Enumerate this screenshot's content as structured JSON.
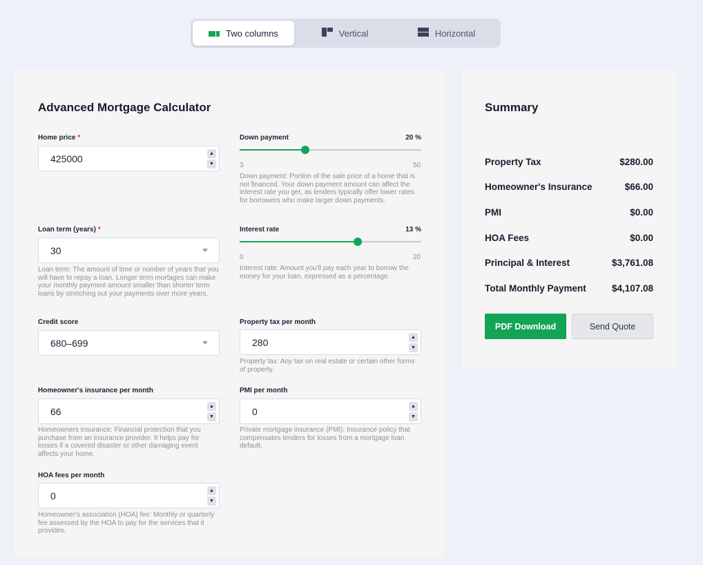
{
  "layout_switcher": {
    "tabs": [
      {
        "label": "Two columns",
        "icon": "two-columns-icon",
        "active": true
      },
      {
        "label": "Vertical",
        "icon": "vertical-layout-icon",
        "active": false
      },
      {
        "label": "Horizontal",
        "icon": "horizontal-layout-icon",
        "active": false
      }
    ]
  },
  "calculator": {
    "title": "Advanced Mortgage Calculator",
    "home_price": {
      "label": "Home price",
      "required_mark": "*",
      "value": "425000"
    },
    "down_payment": {
      "label": "Down payment",
      "value_text": "20 %",
      "value": 20,
      "min": 3,
      "max": 50,
      "min_label": "3",
      "max_label": "50",
      "help": "Down payment: Portion of the sale price of a home that is not financed. Your down payment amount can affect the interest rate you get, as lenders typically offer lower rates for borrowers who make larger down payments."
    },
    "loan_term": {
      "label": "Loan term (years)",
      "required_mark": "*",
      "value": "30",
      "help": "Loan term: The amount of time or number of years that you will have to repay a loan. Longer term mortages can make your monthly payment amount smaller than shorter term loans by stretching out your payments over more years."
    },
    "interest_rate": {
      "label": "Interest rate",
      "value_text": "13 %",
      "value": 13,
      "min": 0,
      "max": 20,
      "min_label": "0",
      "max_label": "20",
      "help": "Interest rate: Amount you'll pay each year to borrow the money for your loan, expressed as a percentage."
    },
    "credit_score": {
      "label": "Credit score",
      "value": "680–699"
    },
    "property_tax": {
      "label": "Property tax per month",
      "value": "280",
      "help": "Property tax: Any tax on real estate or certain other forms of property."
    },
    "homeowners_insurance": {
      "label": "Homeowner's insurance per month",
      "value": "66",
      "help": "Homeowners insurance: Financial protection that you purchase from an insurance provider. It helps pay for losses if a covered disaster or other damaging event affects your home."
    },
    "pmi": {
      "label": "PMI per month",
      "value": "0",
      "help": "Private mortgage insurance (PMI): Insurance policy that compensates lenders for losses from a mortgage loan default."
    },
    "hoa_fees": {
      "label": "HOA fees per month",
      "value": "0",
      "help": "Homeowner's association (HOA) fee: Monthly or quarterly fee assessed by the HOA to pay for the services that it provides."
    }
  },
  "summary": {
    "title": "Summary",
    "rows": [
      {
        "label": "Property Tax",
        "value": "$280.00"
      },
      {
        "label": "Homeowner's Insurance",
        "value": "$66.00"
      },
      {
        "label": "PMI",
        "value": "$0.00"
      },
      {
        "label": "HOA Fees",
        "value": "$0.00"
      },
      {
        "label": "Principal & Interest",
        "value": "$3,761.08"
      },
      {
        "label": "Total Monthly Payment",
        "value": "$4,107.08"
      }
    ],
    "pdf_button": "PDF Download",
    "quote_button": "Send Quote"
  },
  "colors": {
    "accent": "#13a455",
    "background": "#eef1f8",
    "panel": "#f5f5f5"
  }
}
